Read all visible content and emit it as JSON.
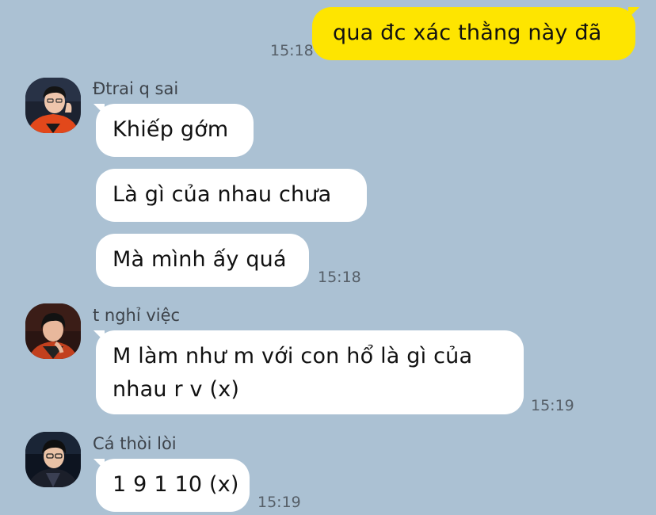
{
  "messages": {
    "outgoing_1": {
      "text": "qua đc xác thằng này đã",
      "time": "15:18"
    },
    "group_1": {
      "sender": "Đtrai q sai",
      "avatar_icon": "person-avatar-icon",
      "bubbles": [
        "Khiếp gớm",
        "Là gì của nhau chưa",
        "Mà mình ấy quá"
      ],
      "time": "15:18"
    },
    "group_2": {
      "sender": "t nghỉ việc",
      "avatar_icon": "person-avatar-icon",
      "bubble_line_1": "M làm như m với con hổ là gì của",
      "bubble_line_2": "nhau r v (x)",
      "time": "15:19"
    },
    "group_3": {
      "sender": "Cá thòi lòi",
      "avatar_icon": "person-avatar-icon",
      "bubble": "1 9 1 10 (x)",
      "time": "15:19"
    }
  },
  "colors": {
    "background": "#abc1d3",
    "outgoing_bubble": "#fee500",
    "incoming_bubble": "#ffffff"
  }
}
